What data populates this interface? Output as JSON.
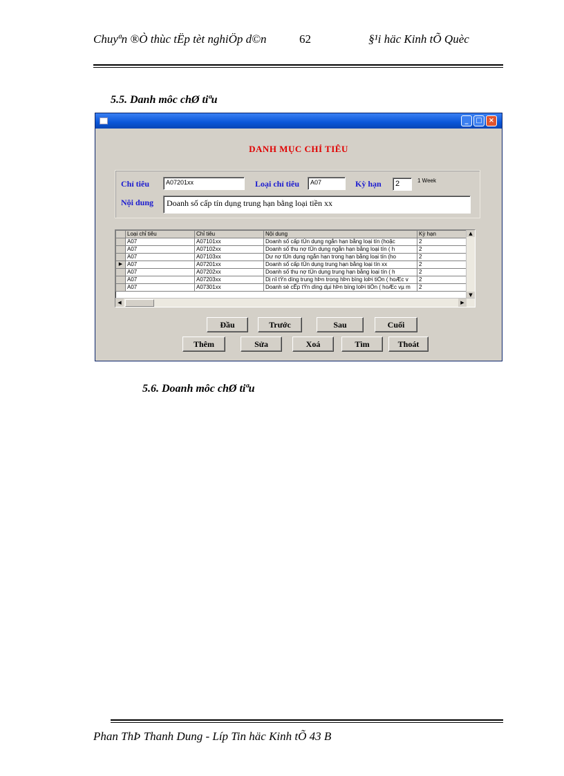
{
  "header": {
    "left_title": "Chuyªn ®Ò thùc tËp tèt nghiÖp d©n",
    "page_number": "62",
    "right_title": "§¹i häc Kinh tÕ Quèc"
  },
  "section_heading": "5.5. Danh môc chØ tiªu",
  "window": {
    "form_title": "DANH MỤC CHỈ TIÊU",
    "labels": {
      "chi_tieu": "Chỉ tiêu",
      "loai_chi_tieu": "Loại chỉ tiêu",
      "ky_han": "Kỳ hạn",
      "noi_dung": "Nội dung"
    },
    "fields": {
      "chi_tieu": "A07201xx",
      "loai_chi_tieu": "A07",
      "ky_han": "2",
      "ky_han_unit": "1 Week",
      "noi_dung": "Doanh số cấp tín dụng trung hạn bằng loại tiền xx"
    },
    "grid": {
      "columns": [
        "Loại chỉ tiêu",
        "Chỉ tiêu",
        "Nội dung",
        "Kỳ hạn"
      ],
      "rows": [
        [
          "A07",
          "A07101xx",
          "Doanh số cấp tÚn dụng ngắn hạn bằng loại tín  (hoặc",
          "2"
        ],
        [
          "A07",
          "A07102xx",
          "Doanh số thu nợ tÚn dụng ngắn hạn bằng loại tín  ( h",
          "2"
        ],
        [
          "A07",
          "A07103xx",
          "Dư nợ tÚn dụng ngắn hạn trong hạn bằng loại tín (ho",
          "2"
        ],
        [
          "A07",
          "A07201xx",
          "Doanh số cấp tÚn dụng trung hạn bằng loại tín xx",
          "2"
        ],
        [
          "A07",
          "A07202xx",
          "Doanh số thu nợ tÚn dụng trung hạn bằng loại tín  ( h",
          "2"
        ],
        [
          "A07",
          "A07203xx",
          "Dị nî tÝn dïng trung hÞn trong hÞn bïng loÞi tiÒn ( hoÆc v",
          "2"
        ],
        [
          "A07",
          "A07301xx",
          "Doanh sè cÊp tÝn dïng dµi hÞn bïng loÞi tiÒn  ( hoÆc vµ m",
          "2"
        ]
      ],
      "selected_row": 3
    },
    "buttons_row1": [
      "Đầu",
      "Trước",
      "Sau",
      "Cuối"
    ],
    "buttons_row2": [
      "Thêm",
      "Sửa",
      "Xoá",
      "Tìm",
      "Thoát"
    ]
  },
  "section_heading_2": "5.6. Doanh môc chØ tiªu",
  "footer": "Phan ThÞ Thanh Dung - Líp Tin häc Kinh tÕ 43 B"
}
